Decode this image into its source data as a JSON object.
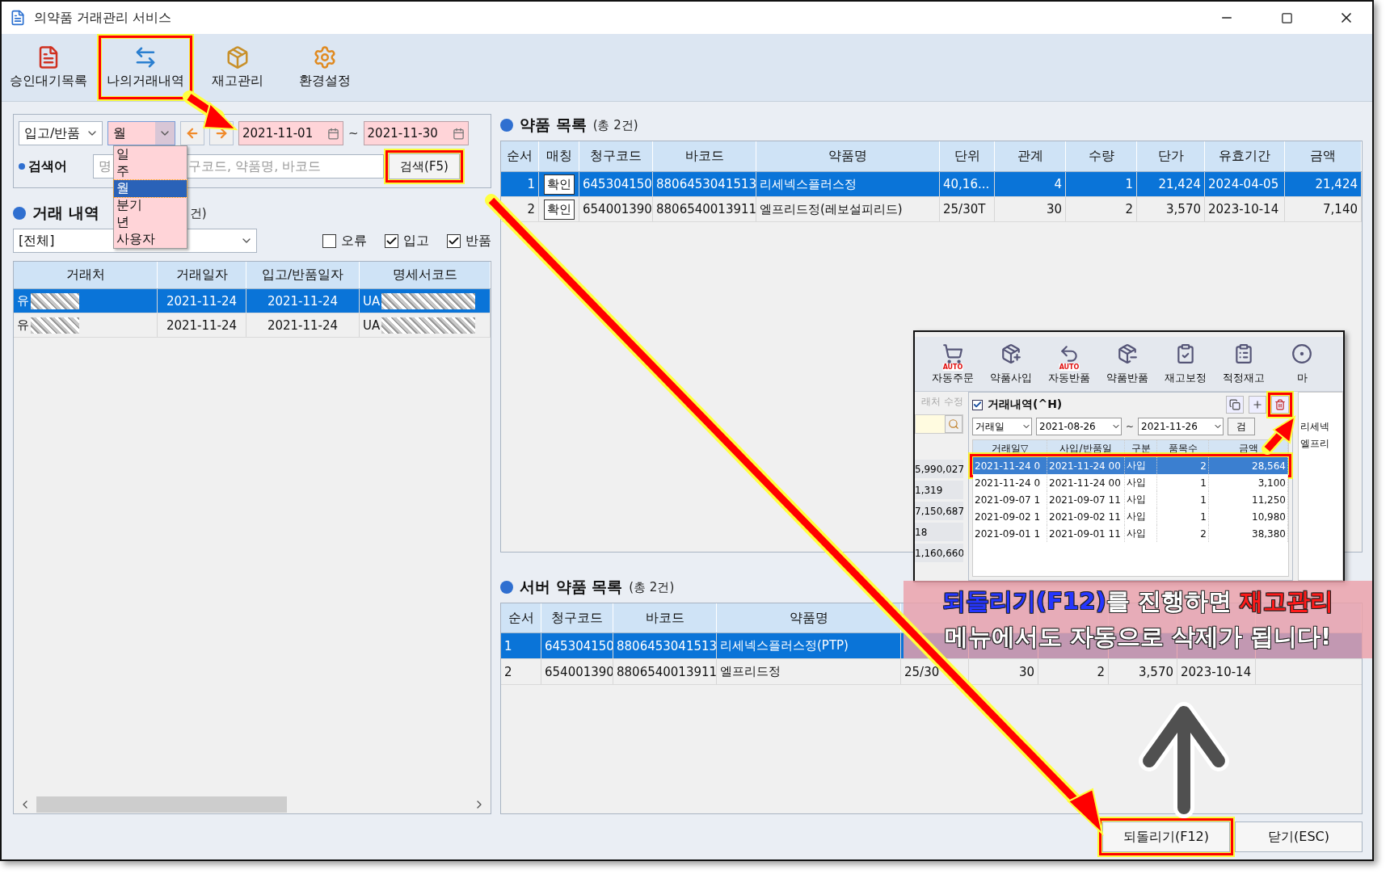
{
  "window": {
    "title": "의약품 거래관리 서비스"
  },
  "toolbar": [
    {
      "label": "승인대기목록",
      "kind": "approval",
      "highlighted": false
    },
    {
      "label": "나의거래내역",
      "kind": "history",
      "highlighted": true
    },
    {
      "label": "재고관리",
      "kind": "stock",
      "highlighted": false
    },
    {
      "label": "환경설정",
      "kind": "settings",
      "highlighted": false
    }
  ],
  "filter": {
    "type_select": "입고/반품",
    "period_select": {
      "value": "월",
      "tinted": true
    },
    "date_from": "2021-11-01",
    "date_separator": "~",
    "date_to": "2021-11-30",
    "search_label": "검색어",
    "search_placeholder_parts": [
      "명",
      "구코드, 약품명, 바코드"
    ],
    "search_button": {
      "label": "검색(F5)",
      "highlighted": true
    }
  },
  "period_dropdown": [
    {
      "label": "일",
      "selected": false
    },
    {
      "label": "주",
      "selected": false
    },
    {
      "label": "월",
      "selected": true
    },
    {
      "label": "분기",
      "selected": false
    },
    {
      "label": "년",
      "selected": false
    },
    {
      "label": "사용자",
      "selected": false
    }
  ],
  "history": {
    "title": "거래 내역",
    "count": "건)",
    "vendor_select": "[전체]",
    "checkboxes": [
      {
        "label": "오류",
        "checked": false
      },
      {
        "label": "입고",
        "checked": true
      },
      {
        "label": "반품",
        "checked": true
      }
    ],
    "columns": [
      "거래처",
      "거래일자",
      "입고/반품일자",
      "명세서코드"
    ],
    "rows": [
      {
        "selected": true,
        "cells": [
          "유",
          "2021-11-24",
          "2021-11-24",
          "UA"
        ]
      },
      {
        "selected": false,
        "cells": [
          "유",
          "2021-11-24",
          "2021-11-24",
          "UA"
        ]
      }
    ]
  },
  "drug_list": {
    "title": "약품 목록",
    "count": "(총 2건)",
    "columns": [
      "순서",
      "매칭",
      "청구코드",
      "바코드",
      "약품명",
      "단위",
      "관계",
      "수량",
      "단가",
      "유효기간",
      "금액"
    ],
    "rows": [
      {
        "selected": true,
        "cells": [
          "1",
          "확인",
          "645304150",
          "8806453041513",
          "리세넥스플러스정",
          "40,16...",
          "4",
          "1",
          "21,424",
          "2024-04-05",
          "21,424"
        ]
      },
      {
        "selected": false,
        "cells": [
          "2",
          "확인",
          "654001390",
          "8806540013911",
          "엘프리드정(레보설피리드)",
          "25/30T",
          "30",
          "2",
          "3,570",
          "2023-10-14",
          "7,140"
        ]
      }
    ]
  },
  "server_list": {
    "title": "서버 약품 목록",
    "count": "(총 2건)",
    "columns": [
      "순서",
      "청구코드",
      "바코드",
      "약품명"
    ],
    "rows": [
      {
        "selected": true,
        "cells": [
          "1",
          "645304150",
          "8806453041513",
          "리세넥스플러스정(PTP)"
        ]
      },
      {
        "selected": false,
        "cells": [
          "2",
          "654001390",
          "8806540013911",
          "엘프리드정",
          "25/30",
          "30",
          "2",
          "3,570",
          "2023-10-14"
        ]
      }
    ]
  },
  "buttons": [
    {
      "label": "되돌리기(F12)",
      "highlighted": true
    },
    {
      "label": "닫기(ESC)",
      "highlighted": false
    }
  ],
  "inset": {
    "toolbar": [
      {
        "label": "자동주문",
        "badge": "AUTO"
      },
      {
        "label": "약품사입"
      },
      {
        "label": "자동반품",
        "badge": "AUTO"
      },
      {
        "label": "약품반품"
      },
      {
        "label": "재고보정"
      },
      {
        "label": "적정재고"
      },
      {
        "label": "마"
      }
    ],
    "side_header": "래처 수정",
    "side_values": [
      "5,990,027",
      "1,319",
      "7,150,687",
      "18",
      "1,160,660"
    ],
    "panel_title": "거래내역(^H)",
    "panel_checked": true,
    "date_type": "거래일",
    "date_from": "2021-08-26",
    "date_separator": "~",
    "date_to": "2021-11-26",
    "search_button": "검",
    "columns": [
      "거래일▽",
      "사입/반품일",
      "구분",
      "품목수",
      "금액"
    ],
    "rows": [
      {
        "selected": true,
        "highlighted": true,
        "cells": [
          "2021-11-24 0",
          "2021-11-24 00",
          "사입",
          "2",
          "28,564"
        ]
      },
      {
        "selected": false,
        "highlighted": false,
        "cells": [
          "2021-11-24 0",
          "2021-11-24 00",
          "사입",
          "1",
          "3,100"
        ]
      },
      {
        "selected": false,
        "highlighted": false,
        "cells": [
          "2021-09-07 1",
          "2021-09-07 11",
          "사입",
          "1",
          "11,250"
        ]
      },
      {
        "selected": false,
        "highlighted": false,
        "cells": [
          "2021-09-02 1",
          "2021-09-02 11",
          "사입",
          "1",
          "10,980"
        ]
      },
      {
        "selected": false,
        "highlighted": false,
        "cells": [
          "2021-09-01 1",
          "2021-09-01 11",
          "사입",
          "2",
          "38,380"
        ]
      }
    ],
    "right_items": [
      "리세넥",
      "엘프리"
    ]
  },
  "annotation": {
    "lines": [
      [
        {
          "text": "되돌리기(F12)",
          "color": "#2636ff"
        },
        {
          "text": "를 진행하면 ",
          "color": "#ffffff"
        },
        {
          "text": "재고관리",
          "color": "#ff1a1a"
        }
      ],
      [
        {
          "text": "메뉴에서도 자동으로 삭제가 됩니다!",
          "color": "#ffffff"
        }
      ]
    ]
  }
}
